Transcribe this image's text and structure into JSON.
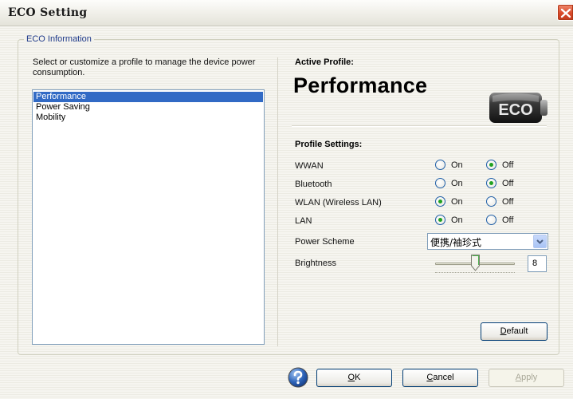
{
  "window": {
    "title": "ECO Setting"
  },
  "group": {
    "legend": "ECO Information",
    "description": "Select or customize a profile to manage the device power consumption."
  },
  "profiles": [
    {
      "label": "Performance",
      "selected": true
    },
    {
      "label": "Power Saving",
      "selected": false
    },
    {
      "label": "Mobility",
      "selected": false
    }
  ],
  "active_profile": {
    "label": "Active Profile:",
    "name": "Performance",
    "badge": "ECO"
  },
  "profile_settings": {
    "label": "Profile Settings:",
    "on_label": "On",
    "off_label": "Off",
    "items": [
      {
        "name": "WWAN",
        "value": "Off"
      },
      {
        "name": "Bluetooth",
        "value": "Off"
      },
      {
        "name": "WLAN (Wireless LAN)",
        "value": "On"
      },
      {
        "name": "LAN",
        "value": "On"
      }
    ],
    "power_scheme": {
      "label": "Power Scheme",
      "value": "便携/袖珍式"
    },
    "brightness": {
      "label": "Brightness",
      "value": "8",
      "level": 8,
      "min": 1,
      "max": 15
    }
  },
  "buttons": {
    "default": {
      "accel": "D",
      "rest": "efault"
    },
    "ok": {
      "accel": "O",
      "rest": "K"
    },
    "cancel": {
      "accel": "C",
      "rest": "ancel"
    },
    "apply": {
      "accel": "A",
      "rest": "pply"
    }
  },
  "colors": {
    "selection": "#316ac5",
    "radio_dot": "#21a121",
    "title_bar": "#eeede6"
  }
}
